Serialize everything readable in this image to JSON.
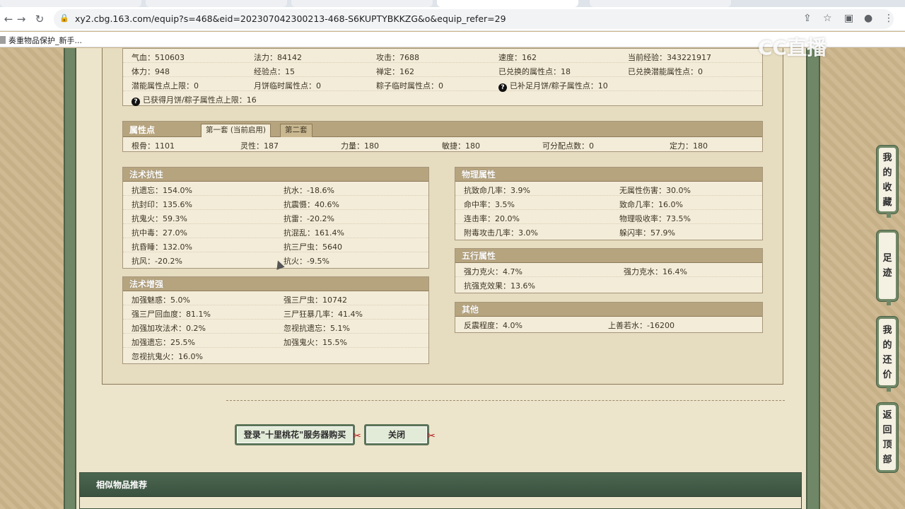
{
  "browser": {
    "url": "xy2.cbg.163.com/equip?s=468&eid=202307042300213-468-S6KUPTYBKKZG&o&equip_refer=29",
    "bookmark": "奏重物品保护_新手..."
  },
  "watermark": "CC直播",
  "basic": {
    "rows": [
      [
        "气血：510603",
        "法力：84142",
        "攻击：7688",
        "速度：162",
        "当前经验：343221917"
      ],
      [
        "体力：948",
        "经验点：15",
        "禅定：162",
        "已兑换的属性点：18",
        "已兑换潜能属性点：0"
      ],
      [
        "潜能属性点上限：0",
        "月饼临时属性点：0",
        "粽子临时属性点：0",
        "已补足月饼/粽子属性点：10",
        ""
      ],
      [
        "已获得月饼/粽子属性点上限：16",
        "",
        "",
        "",
        ""
      ]
    ]
  },
  "attr": {
    "title": "属性点",
    "tab1": "第一套 (当前启用)",
    "tab2": "第二套",
    "values": [
      "根骨：1101",
      "灵性：187",
      "力量：180",
      "敏捷：180",
      "可分配点数：0",
      "定力：180"
    ]
  },
  "magic_resist": {
    "title": "法术抗性",
    "rows": [
      [
        "抗遗忘：154.0%",
        "抗水：-18.6%"
      ],
      [
        "抗封印：135.6%",
        "抗震慑：40.6%"
      ],
      [
        "抗鬼火：59.3%",
        "抗雷：-20.2%"
      ],
      [
        "抗中毒：27.0%",
        "抗混乱：161.4%"
      ],
      [
        "抗昏睡：132.0%",
        "抗三尸虫：5640"
      ],
      [
        "抗风：-20.2%",
        "抗火：-9.5%"
      ]
    ]
  },
  "magic_enhance": {
    "title": "法术增强",
    "rows": [
      [
        "加强魅惑：5.0%",
        "强三尸虫：10742"
      ],
      [
        "强三尸回血度：81.1%",
        "三尸狂暴几率：41.4%"
      ],
      [
        "加强加攻法术：0.2%",
        "忽视抗遗忘：5.1%"
      ],
      [
        "加强遗忘：25.5%",
        "加强鬼火：15.5%"
      ],
      [
        "忽视抗鬼火：16.0%",
        ""
      ]
    ]
  },
  "physical": {
    "title": "物理属性",
    "rows": [
      [
        "抗致命几率：3.9%",
        "无属性伤害：30.0%"
      ],
      [
        "命中率：3.5%",
        "致命几率：16.0%"
      ],
      [
        "连击率：20.0%",
        "物理吸收率：73.5%"
      ],
      [
        "附毒攻击几率：3.0%",
        "躲闪率：57.9%"
      ]
    ]
  },
  "five_elements": {
    "title": "五行属性",
    "rows": [
      [
        "强力克火：4.7%",
        "强力克水：16.4%"
      ],
      [
        "抗强克效果：13.6%",
        ""
      ]
    ]
  },
  "other": {
    "title": "其他",
    "rows": [
      [
        "反震程度：4.0%",
        "上善若水：-16200"
      ]
    ]
  },
  "buttons": {
    "login": "登录\"十里桃花\"服务器购买",
    "close": "关闭"
  },
  "similar": {
    "title": "相似物品推荐"
  },
  "sidenav": {
    "favorites": [
      "我",
      "的",
      "收",
      "藏"
    ],
    "footprint": [
      "足",
      "迹"
    ],
    "bargain": [
      "我",
      "的",
      "还",
      "价"
    ],
    "top": [
      "返",
      "回",
      "顶",
      "部"
    ]
  }
}
